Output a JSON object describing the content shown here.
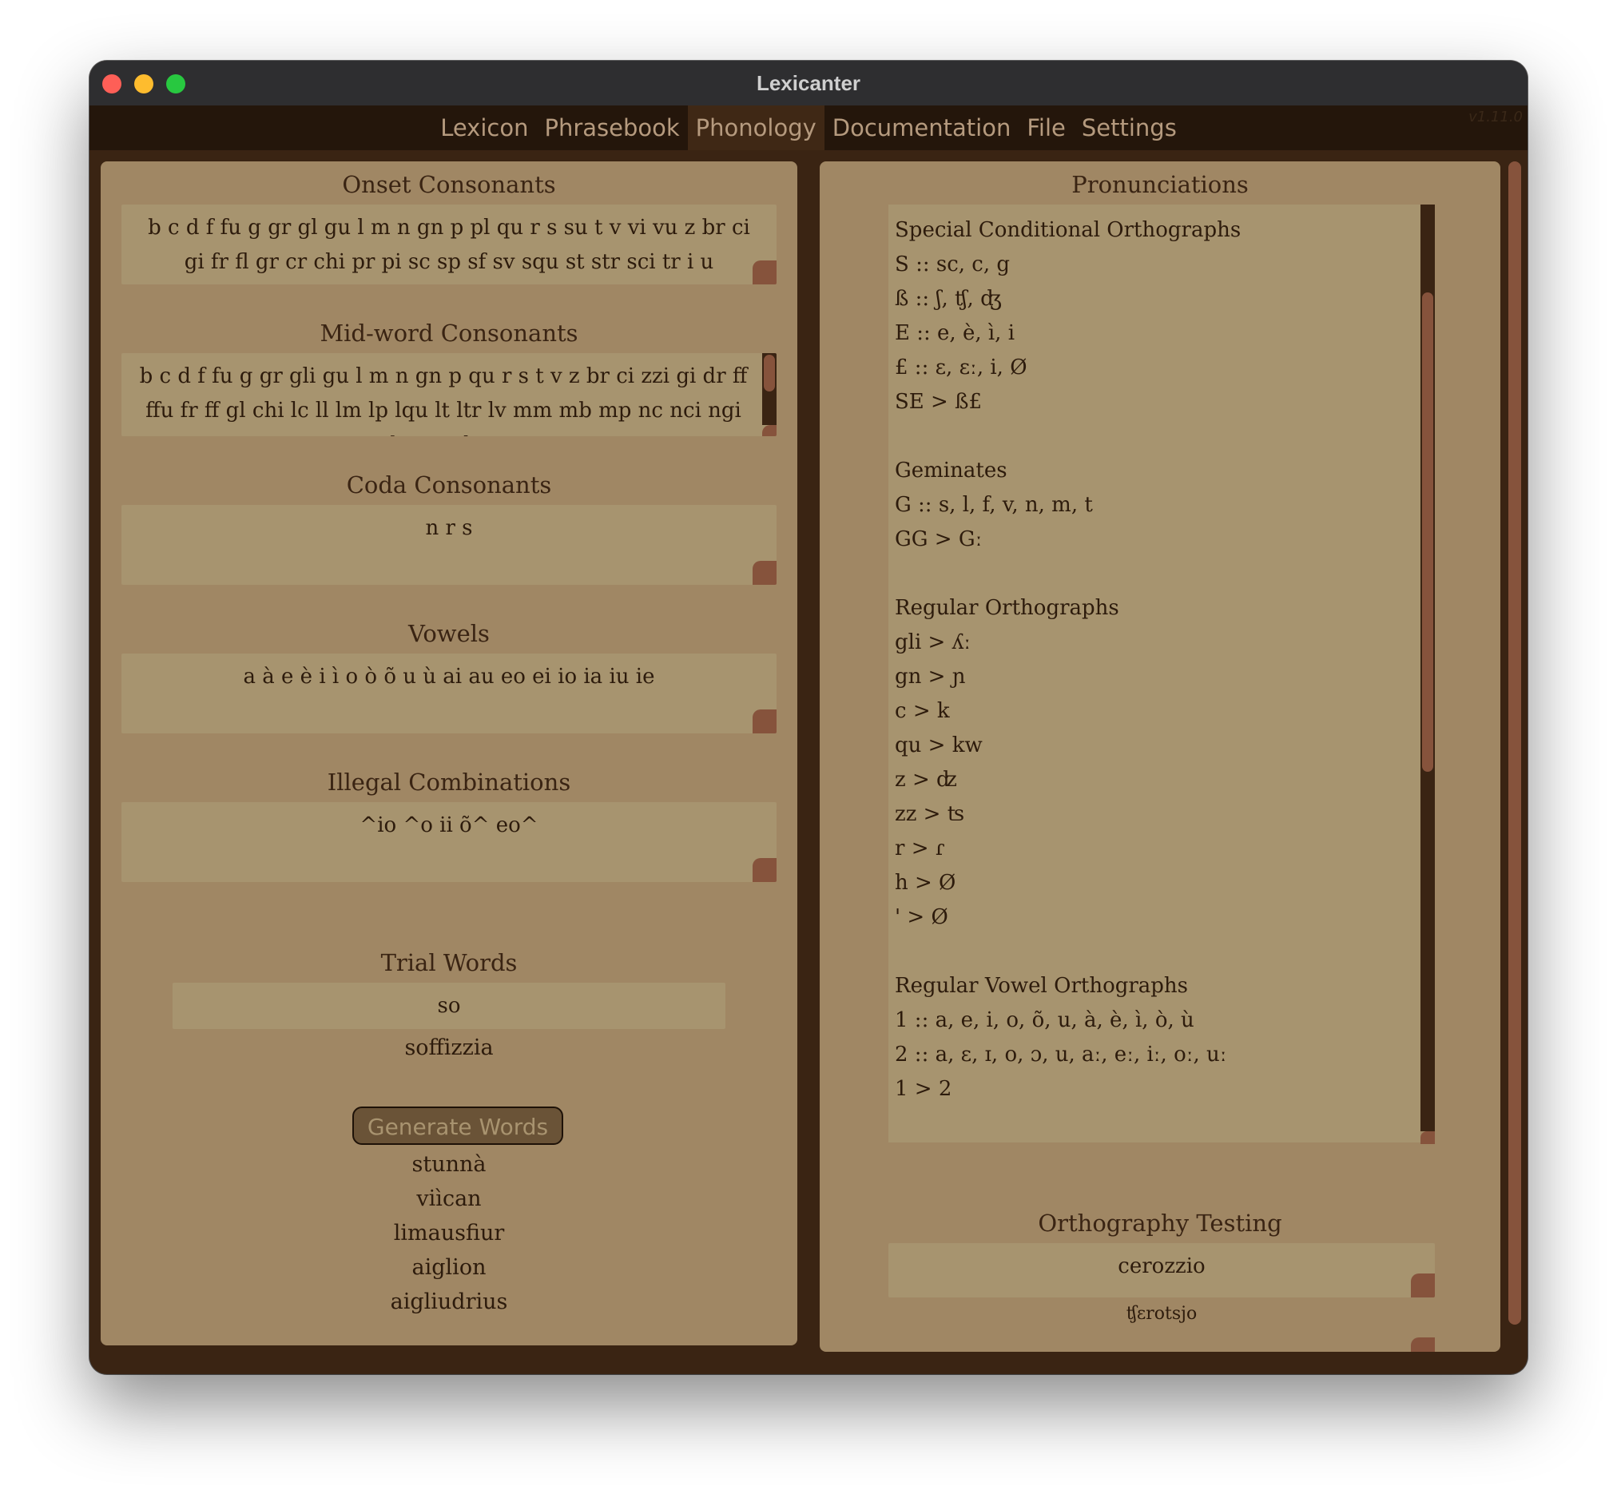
{
  "window": {
    "title": "Lexicanter",
    "version": "v1.11.0"
  },
  "menu": {
    "items": [
      "Lexicon",
      "Phrasebook",
      "Phonology",
      "Documentation",
      "File",
      "Settings"
    ],
    "active": "Phonology"
  },
  "left": {
    "onset": {
      "title": "Onset Consonants",
      "value": "b c d f fu g gr gl gu l m n gn p pl qu r s su t v vi vu z br ci gi fr fl gr cr chi pr pi sc sp sf sv squ st str sci tr i u"
    },
    "mid": {
      "title": "Mid-word Consonants",
      "value": "b c d f fu g gr gli gu l m n gn p qu r s t v z br ci zzi gi dr ff ffu fr ff gl chi lc ll lm lp lqu lt ltr lv mm mb mp nc nci ngi nd ng ngl ngu"
    },
    "coda": {
      "title": "Coda Consonants",
      "value": "n r s"
    },
    "vowels": {
      "title": "Vowels",
      "value": "a à e è i ì o ò õ u ù ai au eo ei io ia iu ie"
    },
    "illegal": {
      "title": "Illegal Combinations",
      "value": "^io ^o ii õ^ eo^"
    },
    "trial": {
      "title": "Trial Words",
      "input": "so",
      "result": "soffizzia"
    },
    "generate_label": "Generate Words",
    "generated": [
      "stunnà",
      "viìcan",
      "limausfiur",
      "aiglion",
      "aigliudrius"
    ]
  },
  "right": {
    "pron_title": "Pronunciations",
    "pron_lines": [
      "Special Conditional Orthographs",
      "S :: sc, c, g",
      "ß :: ʃ, ʧ, ʤ",
      "E :: e, è, ì, i",
      "£ :: ɛ, ɛː, i, Ø",
      "SE > ß£",
      "",
      "Geminates",
      "G :: s, l, f, v, n, m, t",
      "GG > Gː",
      "",
      "Regular Orthographs",
      "gli > ʎː",
      "gn > ɲ",
      "c > k",
      "qu > kw",
      "z > ʣ",
      "zz > ʦ",
      "r > ɾ",
      "h > Ø",
      "' > Ø",
      "",
      "Regular Vowel Orthographs",
      "1 :: a, e, i, o, õ, u, à, è, ì, ò, ù",
      "2 :: a, ɛ, ɪ, o, ɔ, u, aː, eː, iː, oː, uː",
      "1 > 2"
    ],
    "ortho_title": "Orthography Testing",
    "ortho_input": "cerozzio",
    "ortho_result": "ʧɛrotsjo"
  }
}
